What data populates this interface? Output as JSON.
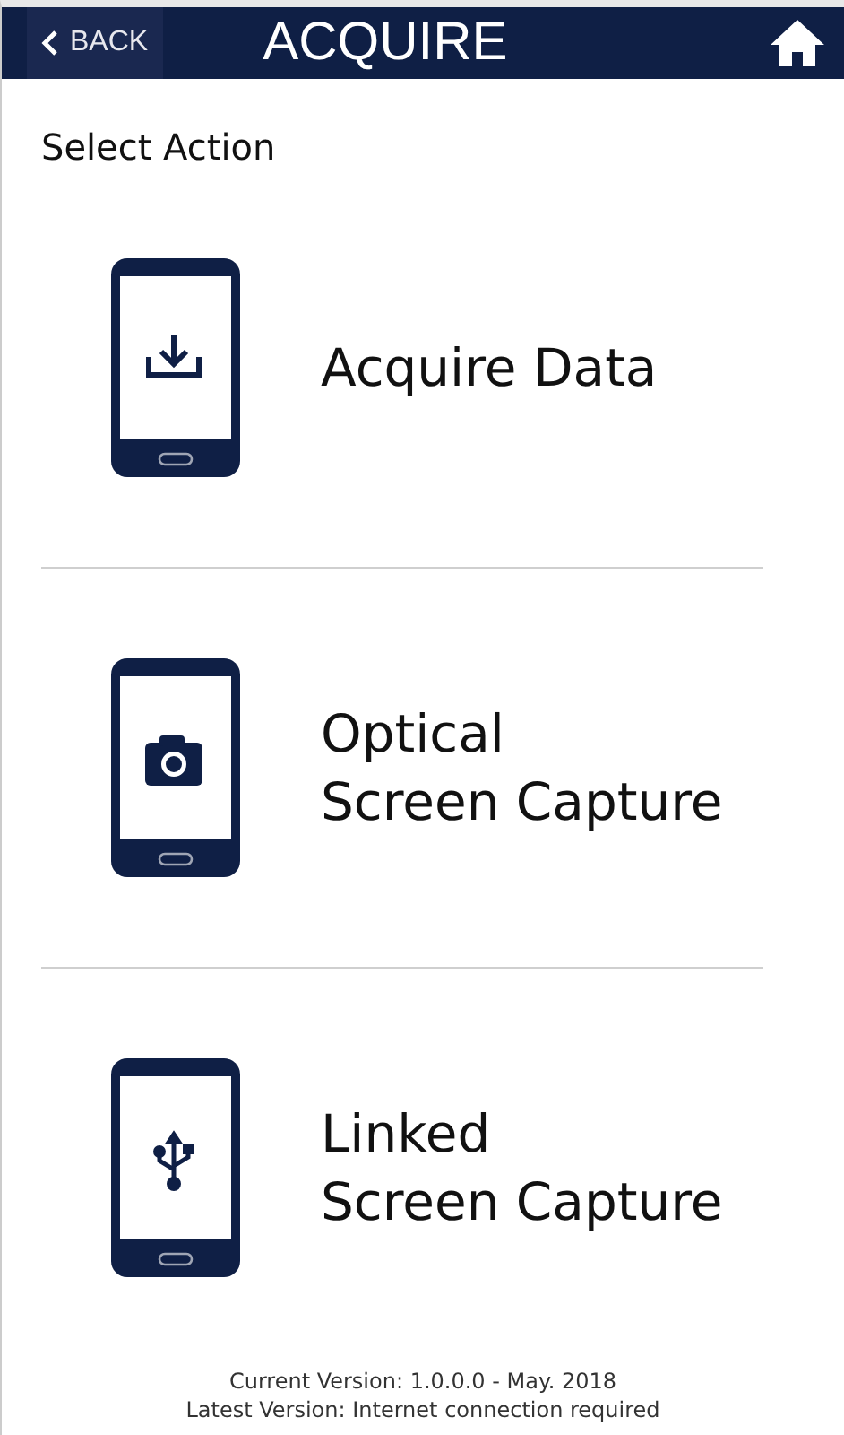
{
  "header": {
    "back_label": "BACK",
    "title": "ACQUIRE"
  },
  "section_title": "Select Action",
  "actions": [
    {
      "kind": "download",
      "lines": [
        "Acquire Data"
      ]
    },
    {
      "kind": "camera",
      "lines": [
        "Optical",
        "Screen Capture"
      ]
    },
    {
      "kind": "usb",
      "lines": [
        "Linked",
        "Screen Capture"
      ]
    }
  ],
  "footer": [
    "Current Version: 1.0.0.0 - May. 2018",
    "Latest Version: Internet connection required"
  ]
}
